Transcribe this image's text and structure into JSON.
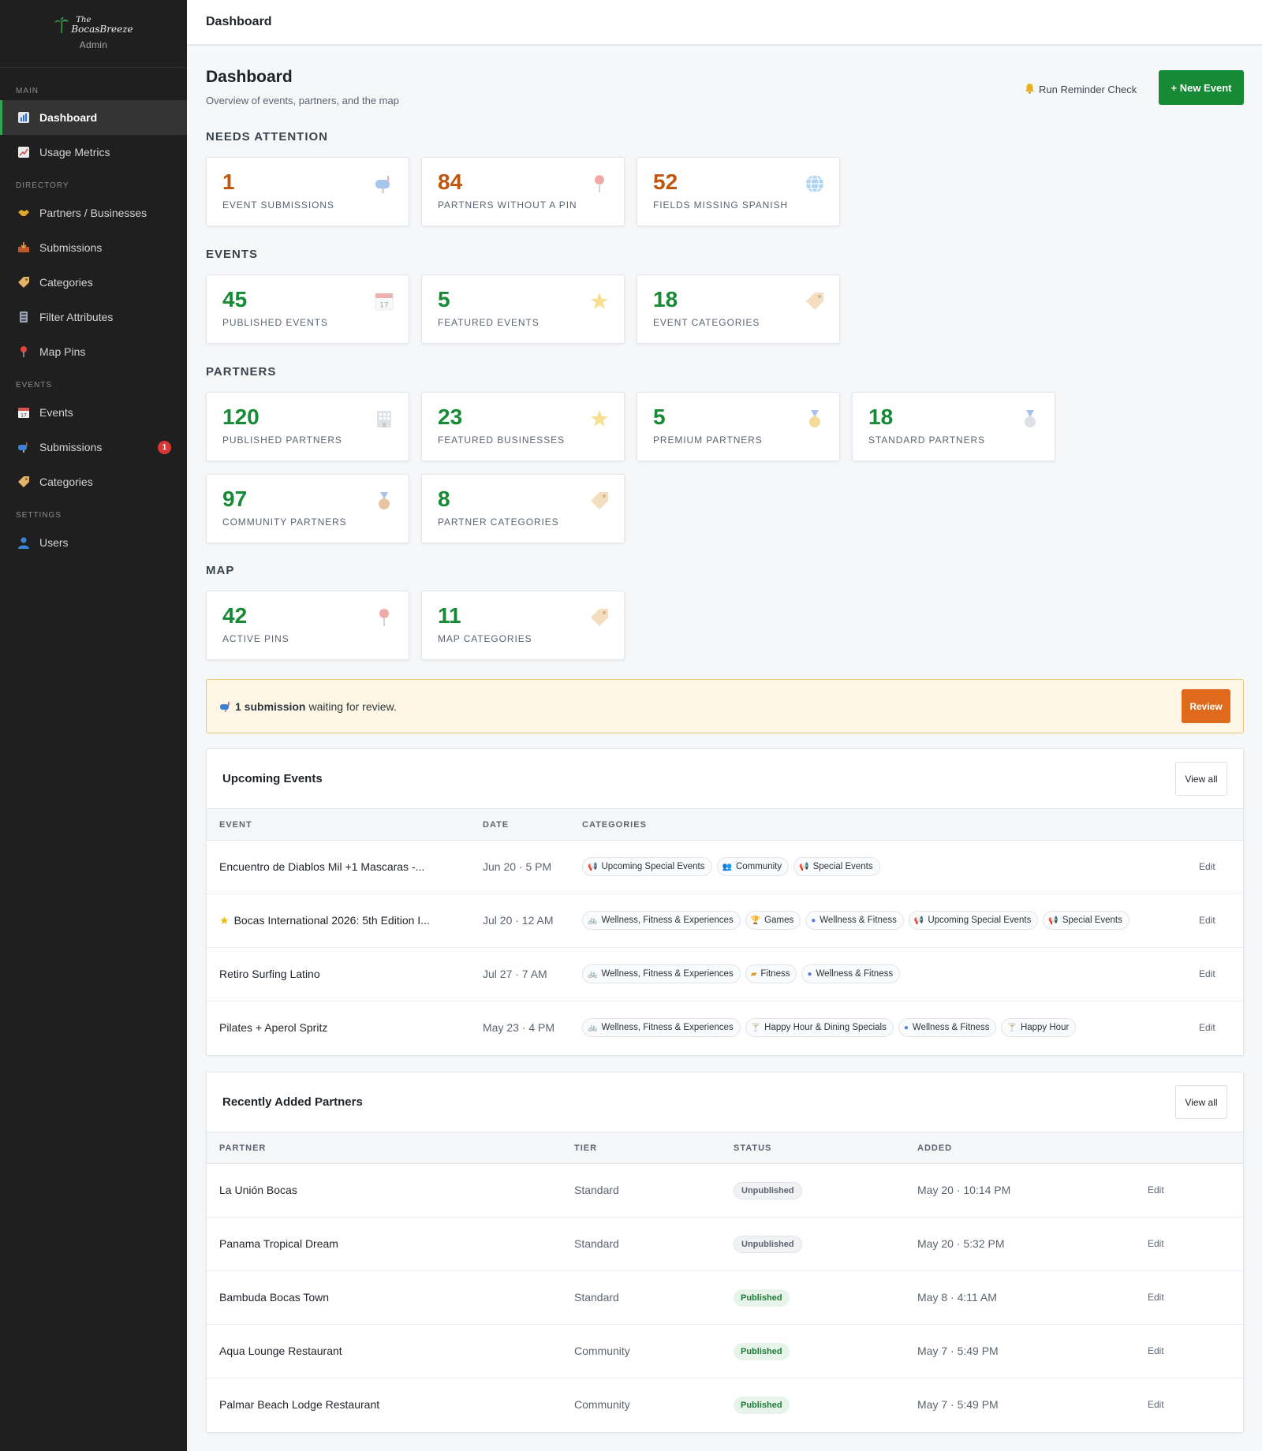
{
  "brand": {
    "logo_line1": "The",
    "logo_line2": "BocasBreeze",
    "subtitle": "Admin"
  },
  "sidebar": {
    "sections": [
      {
        "label": "MAIN"
      },
      {
        "label": "DIRECTORY"
      },
      {
        "label": "EVENTS"
      },
      {
        "label": "SETTINGS"
      }
    ],
    "items": [
      {
        "label": "Dashboard",
        "icon": "chart-icon",
        "active": true
      },
      {
        "label": "Usage Metrics",
        "icon": "trend-icon"
      },
      {
        "label": "Partners / Businesses",
        "icon": "handshake-icon"
      },
      {
        "label": "Submissions",
        "icon": "inbox-icon"
      },
      {
        "label": "Categories",
        "icon": "tag-icon"
      },
      {
        "label": "Filter Attributes",
        "icon": "filter-icon"
      },
      {
        "label": "Map Pins",
        "icon": "pin-icon"
      },
      {
        "label": "Events",
        "icon": "calendar-icon"
      },
      {
        "label": "Submissions",
        "icon": "mailbox-icon",
        "badge": "1"
      },
      {
        "label": "Categories",
        "icon": "tag-icon"
      },
      {
        "label": "Users",
        "icon": "user-icon"
      }
    ]
  },
  "topbar": {
    "title": "Dashboard"
  },
  "header": {
    "title": "Dashboard",
    "subtitle": "Overview of events, partners, and the map",
    "reminder_label": "Run Reminder Check",
    "new_event_label": "+ New Event"
  },
  "sections": {
    "needs_attention": "NEEDS ATTENTION",
    "events": "EVENTS",
    "partners": "PARTNERS",
    "map": "MAP"
  },
  "stats": {
    "event_submissions": {
      "value": "1",
      "label": "EVENT SUBMISSIONS",
      "icon": "mailbox-icon"
    },
    "partners_without_pin": {
      "value": "84",
      "label": "PARTNERS WITHOUT A PIN",
      "icon": "pin-icon"
    },
    "fields_missing_spanish": {
      "value": "52",
      "label": "FIELDS MISSING SPANISH",
      "icon": "globe-icon"
    },
    "published_events": {
      "value": "45",
      "label": "PUBLISHED EVENTS",
      "icon": "calendar-icon"
    },
    "featured_events": {
      "value": "5",
      "label": "FEATURED EVENTS",
      "icon": "star-icon"
    },
    "event_categories": {
      "value": "18",
      "label": "EVENT CATEGORIES",
      "icon": "tag-icon"
    },
    "published_partners": {
      "value": "120",
      "label": "PUBLISHED PARTNERS",
      "icon": "building-icon"
    },
    "featured_businesses": {
      "value": "23",
      "label": "FEATURED BUSINESSES",
      "icon": "star-icon"
    },
    "premium_partners": {
      "value": "5",
      "label": "PREMIUM PARTNERS",
      "icon": "gold-medal-icon"
    },
    "standard_partners": {
      "value": "18",
      "label": "STANDARD PARTNERS",
      "icon": "silver-medal-icon"
    },
    "community_partners": {
      "value": "97",
      "label": "COMMUNITY PARTNERS",
      "icon": "bronze-medal-icon"
    },
    "partner_categories": {
      "value": "8",
      "label": "PARTNER CATEGORIES",
      "icon": "tag-icon"
    },
    "active_pins": {
      "value": "42",
      "label": "ACTIVE PINS",
      "icon": "pin-icon"
    },
    "map_categories": {
      "value": "11",
      "label": "MAP CATEGORIES",
      "icon": "tag-icon"
    }
  },
  "banner": {
    "count_text": "1 submission",
    "rest_text": "waiting for review.",
    "button": "Review"
  },
  "upcoming": {
    "title": "Upcoming Events",
    "view_all": "View all",
    "columns": {
      "event": "EVENT",
      "date": "DATE",
      "categories": "CATEGORIES"
    },
    "edit_label": "Edit",
    "rows": [
      {
        "event": "Encuentro de Diablos Mil +1 Mascaras -...",
        "featured": false,
        "date": "Jun 20 · 5 PM",
        "categories": [
          {
            "label": "Upcoming Special Events",
            "icon": "megaphone-icon"
          },
          {
            "label": "Community",
            "icon": "people-icon"
          },
          {
            "label": "Special Events",
            "icon": "megaphone-icon"
          }
        ]
      },
      {
        "event": "Bocas International 2026: 5th Edition I...",
        "featured": true,
        "date": "Jul 20 · 12 AM",
        "categories": [
          {
            "label": "Wellness, Fitness & Experiences",
            "icon": "bike-icon"
          },
          {
            "label": "Games",
            "icon": "trophy-icon"
          },
          {
            "label": "Wellness & Fitness",
            "icon": "circle-icon"
          },
          {
            "label": "Upcoming Special Events",
            "icon": "megaphone-icon"
          },
          {
            "label": "Special Events",
            "icon": "megaphone-icon"
          }
        ]
      },
      {
        "event": "Retiro Surfing Latino",
        "featured": false,
        "date": "Jul 27 · 7 AM",
        "categories": [
          {
            "label": "Wellness, Fitness & Experiences",
            "icon": "bike-icon"
          },
          {
            "label": "Fitness",
            "icon": "dumbbell-icon"
          },
          {
            "label": "Wellness & Fitness",
            "icon": "circle-icon"
          }
        ]
      },
      {
        "event": "Pilates + Aperol Spritz",
        "featured": false,
        "date": "May 23 · 4 PM",
        "categories": [
          {
            "label": "Wellness, Fitness & Experiences",
            "icon": "bike-icon"
          },
          {
            "label": "Happy Hour & Dining Specials",
            "icon": "cocktail-icon"
          },
          {
            "label": "Wellness & Fitness",
            "icon": "circle-icon"
          },
          {
            "label": "Happy Hour",
            "icon": "cocktail-icon"
          }
        ]
      }
    ]
  },
  "partners": {
    "title": "Recently Added Partners",
    "view_all": "View all",
    "columns": {
      "partner": "PARTNER",
      "tier": "TIER",
      "status": "STATUS",
      "added": "ADDED"
    },
    "edit_label": "Edit",
    "rows": [
      {
        "partner": "La Unión Bocas",
        "tier": "Standard",
        "status": "Unpublished",
        "added": "May 20 · 10:14 PM"
      },
      {
        "partner": "Panama Tropical Dream",
        "tier": "Standard",
        "status": "Unpublished",
        "added": "May 20 · 5:32 PM"
      },
      {
        "partner": "Bambuda Bocas Town",
        "tier": "Standard",
        "status": "Published",
        "added": "May 8 · 4:11 AM"
      },
      {
        "partner": "Aqua Lounge Restaurant",
        "tier": "Community",
        "status": "Published",
        "added": "May 7 · 5:49 PM"
      },
      {
        "partner": "Palmar Beach Lodge Restaurant",
        "tier": "Community",
        "status": "Published",
        "added": "May 7 · 5:49 PM"
      }
    ]
  },
  "colors": {
    "accent_green": "#168a35",
    "warn_orange": "#c0560e",
    "sidebar_bg": "#1f1f1f",
    "review_orange": "#e06a1b"
  }
}
